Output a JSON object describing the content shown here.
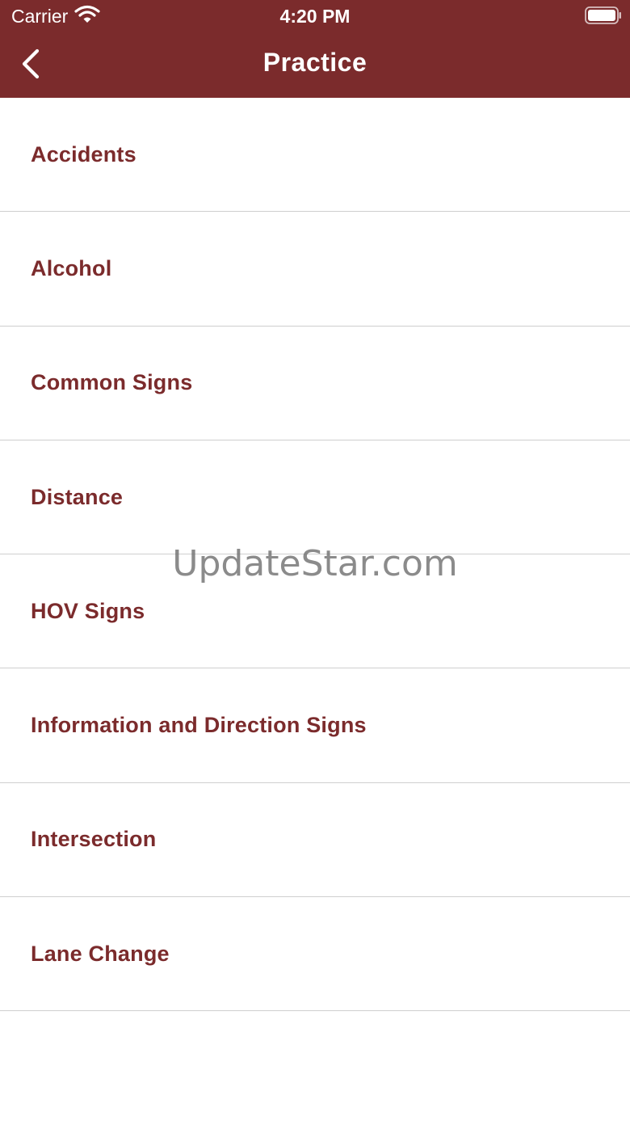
{
  "status_bar": {
    "carrier": "Carrier",
    "time": "4:20 PM",
    "wifi_icon": "wifi-icon",
    "battery_icon": "battery-icon"
  },
  "nav": {
    "title": "Practice",
    "back_icon": "chevron-left-icon"
  },
  "list": {
    "items": [
      {
        "label": "Accidents"
      },
      {
        "label": "Alcohol"
      },
      {
        "label": "Common Signs"
      },
      {
        "label": "Distance"
      },
      {
        "label": "HOV Signs"
      },
      {
        "label": "Information and Direction Signs"
      },
      {
        "label": "Intersection"
      },
      {
        "label": "Lane Change"
      }
    ]
  },
  "watermark": "UpdateStar.com",
  "colors": {
    "brand": "#7b2b2c",
    "separator": "#cfcfcf",
    "background": "#ffffff"
  }
}
